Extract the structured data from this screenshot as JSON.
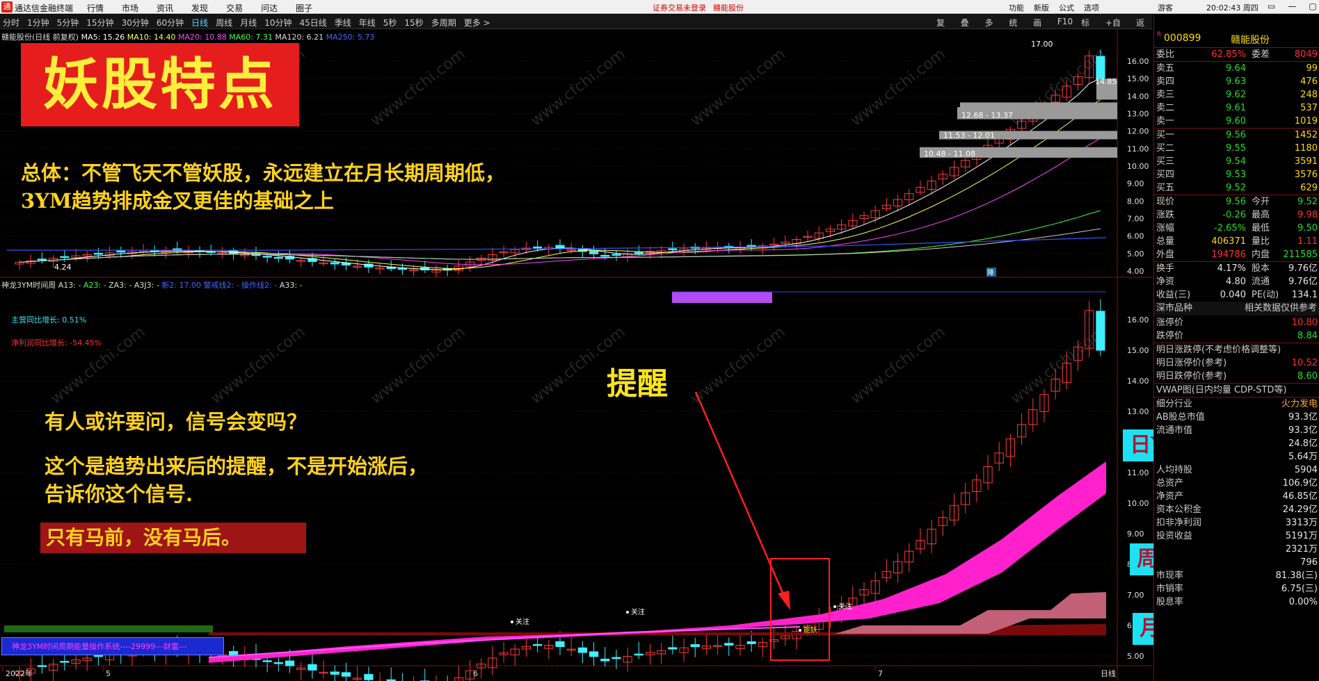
{
  "titlebar": {
    "app_name": "通达信金融终端",
    "menu": [
      "行情",
      "市场",
      "资讯",
      "发现",
      "交易",
      "问达",
      "圈子"
    ],
    "notice": "证券交易未登录",
    "notice_stock": "赣能股份",
    "right_menu": [
      "功能",
      "新版",
      "公式",
      "选项"
    ],
    "user": "游客",
    "clock": "20:02:43 周四",
    "win_buttons": [
      "▭",
      "—",
      "▢",
      "✕"
    ]
  },
  "toolbar": {
    "periods": [
      "分时",
      "1分钟",
      "5分钟",
      "15分钟",
      "30分钟",
      "60分钟",
      "日线",
      "周线",
      "月线",
      "10分钟",
      "45日线",
      "季线",
      "年线",
      "5秒",
      "15秒",
      "多周期",
      "更多 >"
    ],
    "active_period": "日线",
    "tools": [
      "复权",
      "叠加",
      "多股",
      "统计",
      "画线",
      "F10",
      "标记",
      "+自选",
      "返回"
    ]
  },
  "main_chart": {
    "stock_title": "赣能股份(日线 前复权)",
    "ma_labels": [
      {
        "text": "MA5: 15.26",
        "color": "#ffffff"
      },
      {
        "text": "MA10: 14.40",
        "color": "#ffff55"
      },
      {
        "text": "MA20: 10.88",
        "color": "#ff44ff"
      },
      {
        "text": "MA60: 7.31",
        "color": "#44ff44"
      },
      {
        "text": "MA120: 6.21",
        "color": "#dddddd"
      },
      {
        "text": "MA250: 5.73",
        "color": "#4466ff"
      }
    ],
    "high_label": "17.00",
    "right_label": "14.85",
    "low_label": "4.24",
    "chip_labels": [
      "12.68 - 13.37",
      "11.53 - 12.01",
      "10.48 - 11.08"
    ],
    "small_tag": "降",
    "y_ticks": [
      "16.00",
      "15.00",
      "14.00",
      "13.00",
      "12.00",
      "11.00",
      "10.00",
      "9.00",
      "8.00",
      "7.00",
      "6.00",
      "5.00",
      "4.00"
    ]
  },
  "sub_chart": {
    "indicator_name": "神龙3YM时间周",
    "indicator_params": [
      {
        "text": "A13: -",
        "color": "#dddddd"
      },
      {
        "text": "A23: -",
        "color": "#44ff44"
      },
      {
        "text": "ZA3: -",
        "color": "#dddddd"
      },
      {
        "text": "A3J3: -",
        "color": "#dddddd"
      },
      {
        "text": "新2: 17.00",
        "color": "#4466ff"
      },
      {
        "text": "警戒线2: -",
        "color": "#4466ff"
      },
      {
        "text": "操作线2: -",
        "color": "#4466ff"
      },
      {
        "text": "A33: -",
        "color": "#dddddd"
      }
    ],
    "revenue_growth": "主营同比增长: 0.51%",
    "profit_growth": "净利润同比增长: -54.45%",
    "y_ticks": [
      "16.00",
      "15.00",
      "14.00",
      "13.00",
      "12.00",
      "11.00",
      "10.00",
      "9.00",
      "8.00",
      "7.00",
      "6.00",
      "5.00",
      "4.00"
    ],
    "tags": [
      "关注",
      "关注",
      "能妖",
      "关注"
    ],
    "x_labels": [
      "2022年",
      "5",
      "6",
      "7"
    ],
    "x_right_label": "日线",
    "system_label": "神龙3YM时间周期能量操作系统----29999---财富---"
  },
  "overlay": {
    "title": "妖股特点",
    "summary_line1": "总体：不管飞天不管妖股，永远建立在月长期周期低，",
    "summary_line2": "3YM趋势排成金叉更佳的基础之上",
    "question": "有人或许要问，信号会变吗？",
    "answer_line1": "这个是趋势出来后的提醒，不是开始涨后，",
    "answer_line2": "告诉你这个信号.",
    "box_text": "只有马前，没有马后。",
    "remind": "提醒",
    "ym_day": "日YM金叉",
    "ym_week": "周YM金叉",
    "ym_month": "月YM金叉"
  },
  "right_panel": {
    "code": "000899",
    "name": "赣能股份",
    "r_badge": "R",
    "weibi": {
      "label": "委比",
      "value": "62.85%",
      "label2": "委差",
      "value2": "8049"
    },
    "sell": [
      {
        "label": "卖五",
        "price": "9.64",
        "vol": "99"
      },
      {
        "label": "卖四",
        "price": "9.63",
        "vol": "476"
      },
      {
        "label": "卖三",
        "price": "9.62",
        "vol": "248"
      },
      {
        "label": "卖二",
        "price": "9.61",
        "vol": "537"
      },
      {
        "label": "卖一",
        "price": "9.60",
        "vol": "1019"
      }
    ],
    "buy": [
      {
        "label": "买一",
        "price": "9.56",
        "vol": "1452"
      },
      {
        "label": "买二",
        "price": "9.55",
        "vol": "1180"
      },
      {
        "label": "买三",
        "price": "9.54",
        "vol": "3591"
      },
      {
        "label": "买四",
        "price": "9.53",
        "vol": "3576"
      },
      {
        "label": "买五",
        "price": "9.52",
        "vol": "629"
      }
    ],
    "quote": [
      {
        "l1": "现价",
        "v1": "9.56",
        "c1": "green",
        "l2": "今开",
        "v2": "9.52",
        "c2": "green"
      },
      {
        "l1": "涨跌",
        "v1": "-0.26",
        "c1": "green",
        "l2": "最高",
        "v2": "9.98",
        "c2": "red"
      },
      {
        "l1": "涨幅",
        "v1": "-2.65%",
        "c1": "green",
        "l2": "最低",
        "v2": "9.50",
        "c2": "green"
      },
      {
        "l1": "总量",
        "v1": "406371",
        "c1": "yellow",
        "l2": "量比",
        "v2": "1.11",
        "c2": "red"
      },
      {
        "l1": "外盘",
        "v1": "194786",
        "c1": "red",
        "l2": "内盘",
        "v2": "211585",
        "c2": "green"
      }
    ],
    "stats": [
      {
        "l1": "换手",
        "v1": "4.17%",
        "l2": "股本",
        "v2": "9.76亿"
      },
      {
        "l1": "净资",
        "v1": "4.80",
        "l2": "流通",
        "v2": "9.76亿"
      },
      {
        "l1": "收益(三)",
        "v1": "0.040",
        "l2": "PE(动)",
        "v2": "134.1"
      }
    ],
    "section_title": "深市品种",
    "section_note": "相关数据仅供参考",
    "limits": [
      {
        "label": "涨停价",
        "value": "10.80",
        "color": "red"
      },
      {
        "label": "跌停价",
        "value": "8.84",
        "color": "green"
      }
    ],
    "tomorrow": [
      {
        "label": "明日涨跌停(不考虑价格调整等)",
        "value": "",
        "color": "white"
      },
      {
        "label": "明日涨停价(参考)",
        "value": "10.52",
        "color": "red"
      },
      {
        "label": "明日跌停价(参考)",
        "value": "8.60",
        "color": "green"
      }
    ],
    "vwap": "VWAP图(日内均量 CDP-STD等)",
    "industry": {
      "label": "细分行业",
      "value": "火力发电"
    },
    "fundamentals": [
      {
        "label": "AB股总市值",
        "value": "93.3亿"
      },
      {
        "label": "流通市值",
        "value": "93.3亿"
      },
      {
        "label": "",
        "value": "24.8亿"
      },
      {
        "label": "",
        "value": "5.64万"
      },
      {
        "label": "人均持股",
        "value": "5904"
      },
      {
        "label": "总资产",
        "value": "106.9亿"
      },
      {
        "label": "净资产",
        "value": "46.85亿"
      },
      {
        "label": "资本公积金",
        "value": "24.29亿"
      },
      {
        "label": "扣非净利润",
        "value": "3313万"
      },
      {
        "label": "投资收益",
        "value": "5191万"
      },
      {
        "label": "",
        "value": "2321万"
      },
      {
        "label": "",
        "value": "796"
      },
      {
        "label": "市现率",
        "value": "81.38(三)"
      },
      {
        "label": "市销率",
        "value": "6.75(三)"
      },
      {
        "label": "股息率",
        "value": "0.00%"
      }
    ]
  }
}
